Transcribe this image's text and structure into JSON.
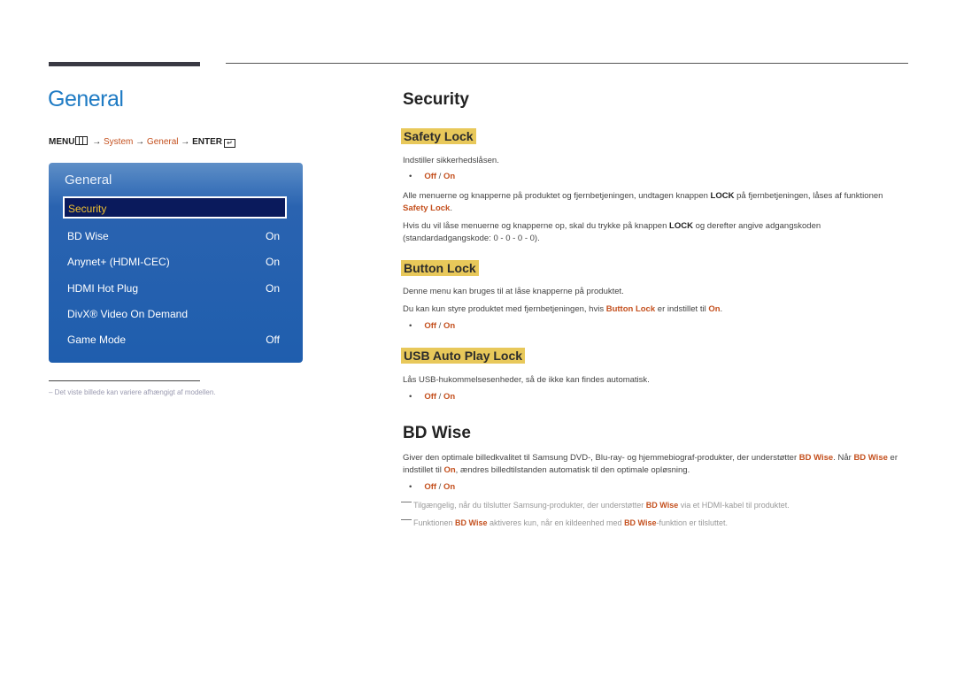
{
  "page": {
    "title": "General",
    "breadcrumb": {
      "menu": "MENU",
      "arrow": "→",
      "system": "System",
      "general": "General",
      "enter": "ENTER",
      "enter_icon": "↵"
    }
  },
  "osd_menu": {
    "title": "General",
    "selected": "Security",
    "items": [
      {
        "label": "BD Wise",
        "value": "On"
      },
      {
        "label": "Anynet+ (HDMI-CEC)",
        "value": "On"
      },
      {
        "label": "HDMI Hot Plug",
        "value": "On"
      },
      {
        "label": "DivX® Video On Demand",
        "value": ""
      },
      {
        "label": "Game Mode",
        "value": "Off"
      }
    ]
  },
  "footnote": "Det viste billede kan variere afhængigt af modellen.",
  "security": {
    "heading": "Security",
    "safety_lock": {
      "heading": "Safety Lock",
      "desc": "Indstiller sikkerhedslåsen.",
      "opt_off": "Off",
      "opt_sep": " / ",
      "opt_on": "On",
      "p1_a": "Alle menuerne og knapperne på produktet og fjernbetjeningen, undtagen knappen ",
      "p1_lock": "LOCK",
      "p1_b": " på fjernbetjeningen, låses af funktionen ",
      "p1_red": "Safety Lock",
      "p1_c": ".",
      "p2_a": "Hvis du vil låse menuerne og knapperne op, skal du trykke på knappen ",
      "p2_lock": "LOCK",
      "p2_b": " og derefter angive adgangskoden (standardadgangskode: 0 - 0 - 0 - 0)."
    },
    "button_lock": {
      "heading": "Button Lock",
      "desc": "Denne menu kan bruges til at låse knapperne på produktet.",
      "p_a": "Du kan kun styre produktet med fjernbetjeningen, hvis ",
      "p_red": "Button Lock",
      "p_b": " er indstillet til ",
      "p_on": "On",
      "p_c": ".",
      "opt_off": "Off",
      "opt_sep": " / ",
      "opt_on": "On"
    },
    "usb_lock": {
      "heading": "USB Auto Play Lock",
      "desc": "Lås USB-hukommelsesenheder, så de ikke kan findes automatisk.",
      "opt_off": "Off",
      "opt_sep": " / ",
      "opt_on": "On"
    }
  },
  "bd_wise": {
    "heading": "BD Wise",
    "p_a": "Giver den optimale billedkvalitet til Samsung DVD-, Blu-ray- og hjemmebiograf-produkter, der understøtter ",
    "p_red1": "BD Wise",
    "p_b": ". Når ",
    "p_red2": "BD Wise",
    "p_c": " er indstillet til ",
    "p_on": "On",
    "p_d": ", ændres billedtilstanden automatisk til den optimale opløsning.",
    "opt_off": "Off",
    "opt_sep": " / ",
    "opt_on": "On",
    "note1_a": "Tilgængelig, når du tilslutter Samsung-produkter, der understøtter ",
    "note1_red": "BD Wise",
    "note1_b": " via et HDMI-kabel til produktet.",
    "note2_a": "Funktionen ",
    "note2_red1": "BD Wise",
    "note2_b": " aktiveres kun, når en kildeenhed med ",
    "note2_red2": "BD Wise",
    "note2_c": "-funktion er tilsluttet."
  },
  "colors": {
    "title_blue": "#1f7bc4",
    "accent_red": "#c4501e",
    "highlight_yellow": "#e8c85a",
    "panel_blue": "#1f5eae",
    "selection_navy": "#0a1a5c",
    "selection_text": "#f0c030"
  }
}
